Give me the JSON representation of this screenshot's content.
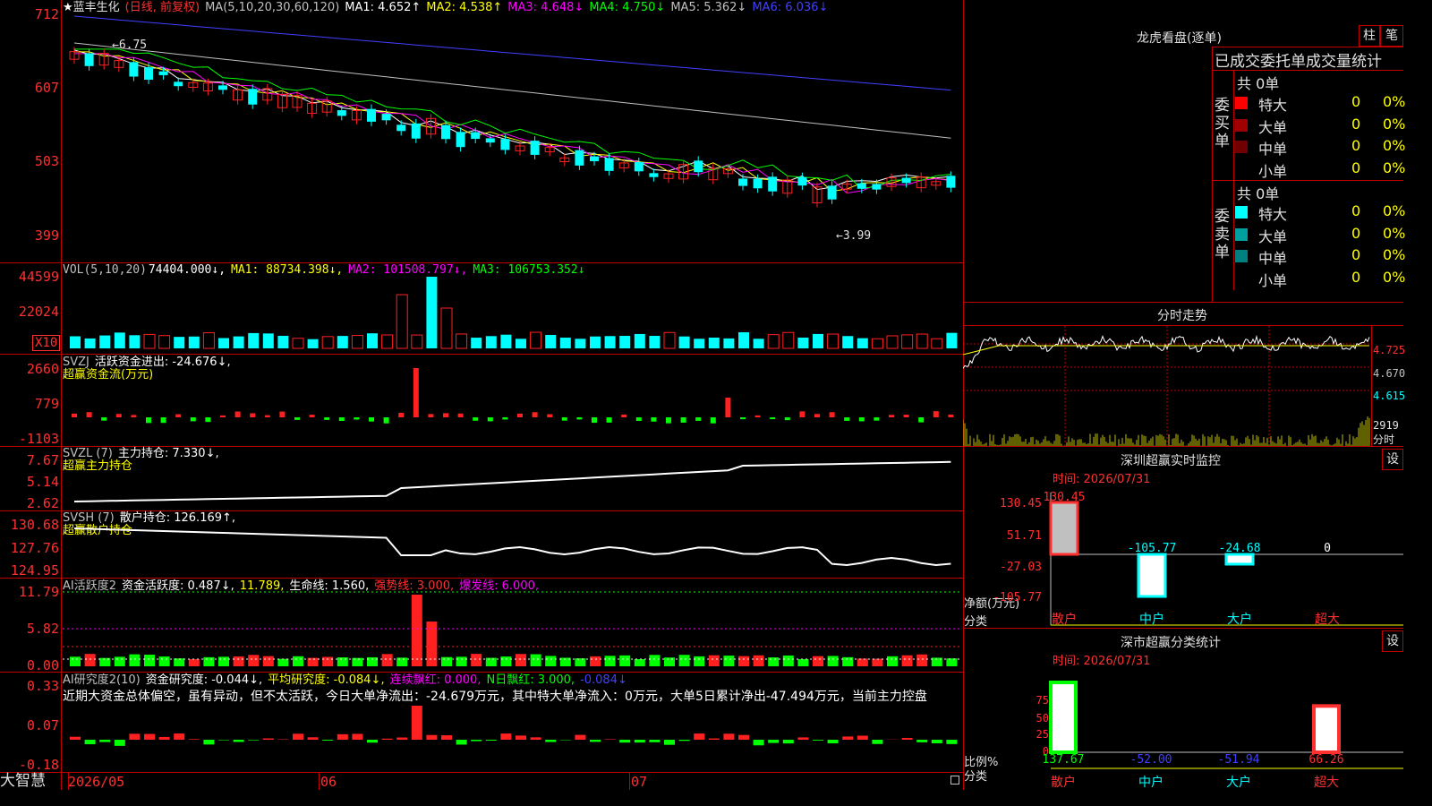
{
  "app": {
    "brand": "大智慧"
  },
  "main_header": {
    "star": "★",
    "stock_name": "蓝丰生化",
    "mode": "(日线, 前复权)",
    "ma_params": "MA(5,10,20,30,60,120)",
    "ma1": "MA1: 4.652↑",
    "ma2": "MA2: 4.538↑",
    "ma3": "MA3: 4.648↓",
    "ma4": "MA4: 4.750↓",
    "ma5": "MA5: 5.362↓",
    "ma6": "MA6: 6.036↓",
    "colors": {
      "ma1": "#ffffff",
      "ma2": "#ffff00",
      "ma3": "#ff00ff",
      "ma4": "#00ff00",
      "ma5": "#c0c0c0",
      "ma6": "#4040ff"
    }
  },
  "price_axis": [
    "712",
    "607",
    "503",
    "399"
  ],
  "price_annotations": {
    "high": "6.75",
    "low": "3.99"
  },
  "vol_header": {
    "params": "VOL(5,10,20)",
    "v": "74404.000↓,",
    "ma1": "MA1: 88734.398↓,",
    "ma2": "MA2: 101508.797↓,",
    "ma3": "MA3: 106753.352↓"
  },
  "vol_axis": [
    "44599",
    "22024"
  ],
  "vol_unit": "X10",
  "svzj_header": {
    "name": "SVZJ",
    "text": "活跃资金进出: -24.676↓,",
    "sub": "超赢资金流(万元)"
  },
  "svzj_axis": [
    "2660",
    "779",
    "-1103"
  ],
  "svzl_header": {
    "name": "SVZL (7)",
    "text": "主力持仓: 7.330↓,",
    "sub": "超赢主力持仓"
  },
  "svzl_axis": [
    "7.67",
    "5.14",
    "2.62"
  ],
  "svsh_header": {
    "name": "SVSH (7)",
    "text": "散户持仓: 126.169↑,",
    "sub": "超赢散户持仓"
  },
  "svsh_axis": [
    "130.68",
    "127.76",
    "124.95"
  ],
  "ai1_header": {
    "name": "AI活跃度2",
    "a": "资金活跃度: 0.487↓,",
    "b": "11.789,",
    "c": "生命线: 1.560,",
    "d": "强势线: 3.000,",
    "e": "爆发线: 6.000,"
  },
  "ai1_axis": [
    "11.79",
    "5.82",
    "0.00"
  ],
  "ai2_header": {
    "name": "AI研究度2(10)",
    "a": "资金研究度: -0.044↓,",
    "b": "平均研究度: -0.084↓,",
    "c": "连续飘红: 0.000,",
    "d": "N日飘红: 3.000,",
    "e": "-0.084↓"
  },
  "ai2_axis": [
    "0.33",
    "0.07",
    "-0.18"
  ],
  "commentary": "近期大资金总体偏空，虽有异动，但不太活跃，今日大单净流出：-24.679万元，其中特大单净流入：0万元，大单5日累计净出-47.494万元，当前主力控盘",
  "dates": [
    "2026/05",
    "06",
    "07"
  ],
  "right_panel": {
    "dragon_title": "龙虎看盘(逐单)",
    "btn_col": "柱",
    "btn_pen": "笔",
    "tab_title": "已成交委托单成交量统计",
    "buy_label": "委买单",
    "sell_label": "委卖单",
    "buy_total": "共 0单",
    "sell_total": "共 0单",
    "buy_rows": [
      {
        "name": "特大",
        "v1": "0",
        "v2": "0%",
        "color": "#ff0000"
      },
      {
        "name": "大单",
        "v1": "0",
        "v2": "0%",
        "color": "#a00000"
      },
      {
        "name": "中单",
        "v1": "0",
        "v2": "0%",
        "color": "#700000"
      },
      {
        "name": "小单",
        "v1": "0",
        "v2": "0%",
        "color": "#000000"
      }
    ],
    "sell_rows": [
      {
        "name": "特大",
        "v1": "0",
        "v2": "0%",
        "color": "#00ffff"
      },
      {
        "name": "大单",
        "v1": "0",
        "v2": "0%",
        "color": "#00a0a0"
      },
      {
        "name": "中单",
        "v1": "0",
        "v2": "0%",
        "color": "#008080"
      },
      {
        "name": "小单",
        "v1": "0",
        "v2": "0%",
        "color": "#000000"
      }
    ],
    "intraday_title": "分时走势",
    "intraday_prices": [
      "4.725",
      "4.670",
      "4.615"
    ],
    "intraday_vol": "2919",
    "intraday_vol_unit": "分时",
    "monitor_title": "深圳超赢实时监控",
    "monitor_btn": "设",
    "monitor_time": "时间: 2026/07/31",
    "monitor_axis": [
      "130.45",
      "51.71",
      "-27.03",
      "-105.77"
    ],
    "monitor_values": [
      "130.45",
      "-105.77",
      "-24.68",
      "0"
    ],
    "monitor_unit": "净额(万元)",
    "monitor_cat_label": "分类",
    "categories": [
      "散户",
      "中户",
      "大户",
      "超大"
    ],
    "stat_title": "深市超赢分类统计",
    "stat_btn": "设",
    "stat_time": "时间: 2026/07/31",
    "stat_axis": [
      "75",
      "50",
      "25",
      "0"
    ],
    "stat_values": [
      "137.67",
      "-52.00",
      "-51.94",
      "66.26"
    ],
    "stat_unit": "比例%",
    "stat_cat_label": "分类"
  }
}
